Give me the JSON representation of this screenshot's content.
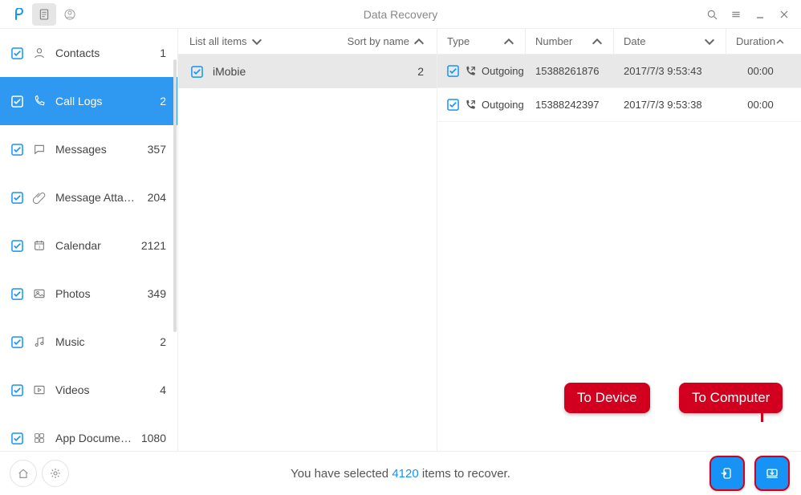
{
  "titlebar": {
    "title": "Data Recovery"
  },
  "sidebar": {
    "items": [
      {
        "label": "Contacts",
        "count": "1"
      },
      {
        "label": "Call Logs",
        "count": "2"
      },
      {
        "label": "Messages",
        "count": "357"
      },
      {
        "label": "Message Attach...",
        "count": "204"
      },
      {
        "label": "Calendar",
        "count": "2121"
      },
      {
        "label": "Photos",
        "count": "349"
      },
      {
        "label": "Music",
        "count": "2"
      },
      {
        "label": "Videos",
        "count": "4"
      },
      {
        "label": "App Documents",
        "count": "1080"
      }
    ]
  },
  "middle": {
    "listall": "List all items",
    "sortby": "Sort by name",
    "rows": [
      {
        "name": "iMobie",
        "count": "2"
      }
    ]
  },
  "columns": {
    "type": "Type",
    "number": "Number",
    "date": "Date",
    "duration": "Duration"
  },
  "rows": [
    {
      "type": "Outgoing",
      "number": "15388261876",
      "date": "2017/7/3 9:53:43",
      "duration": "00:00"
    },
    {
      "type": "Outgoing",
      "number": "15388242397",
      "date": "2017/7/3 9:53:38",
      "duration": "00:00"
    }
  ],
  "footer": {
    "prefix": "You have selected ",
    "count": "4120",
    "suffix": " items to recover."
  },
  "callouts": {
    "device": "To Device",
    "computer": "To Computer"
  }
}
